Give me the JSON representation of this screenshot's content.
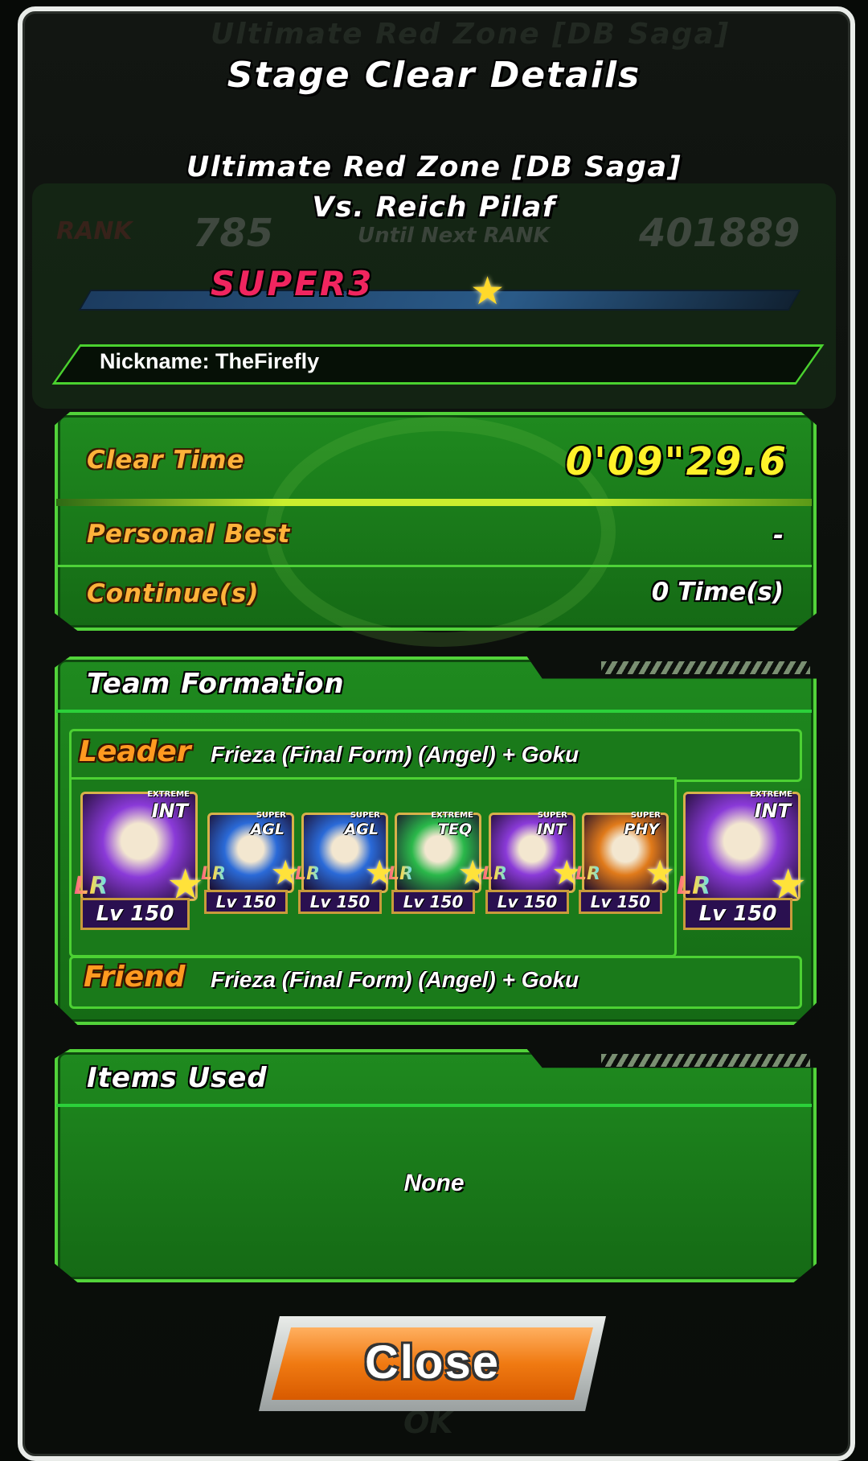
{
  "dialog": {
    "title": "Stage Clear Details",
    "stage_name": "Ultimate Red Zone [DB Saga]",
    "opponent": "Vs. Reich Pilaf"
  },
  "background_ghost": {
    "header": "Ultimate Red Zone [DB Saga]",
    "rank_label": "RANK",
    "rank_value": "785",
    "until_next": "Until Next RANK",
    "next_value": "401889",
    "ok_label": "OK"
  },
  "rank": {
    "tier": "SUPER3",
    "star_icon": "star-icon"
  },
  "nickname": {
    "text": "Nickname:  TheFirefly"
  },
  "stats": {
    "clear_time_label": "Clear Time",
    "clear_time_value": "0'09\"29.6",
    "personal_best_label": "Personal Best",
    "personal_best_value": "-",
    "continues_label": "Continue(s)",
    "continues_value": "0 Time(s)"
  },
  "team": {
    "title": "Team Formation",
    "leader_label": "Leader",
    "leader_name": "Frieza (Final Form) (Angel) + Goku",
    "friend_label": "Friend",
    "friend_name": "Frieza (Final Form) (Angel) + Goku",
    "cards": [
      {
        "tag": "EXTREME",
        "type": "INT",
        "rarity": "LR",
        "level": "Lv 150",
        "color": "#8a3ad8",
        "role": "leader"
      },
      {
        "tag": "SUPER",
        "type": "AGL",
        "rarity": "LR",
        "level": "Lv 150",
        "color": "#2a6ad8",
        "role": "member"
      },
      {
        "tag": "SUPER",
        "type": "AGL",
        "rarity": "LR",
        "level": "Lv 150",
        "color": "#2a6ad8",
        "role": "member"
      },
      {
        "tag": "EXTREME",
        "type": "TEQ",
        "rarity": "LR",
        "level": "Lv 150",
        "color": "#2ab84a",
        "role": "member"
      },
      {
        "tag": "SUPER",
        "type": "INT",
        "rarity": "LR",
        "level": "Lv 150",
        "color": "#8a3ad8",
        "role": "member"
      },
      {
        "tag": "SUPER",
        "type": "PHY",
        "rarity": "LR",
        "level": "Lv 150",
        "color": "#e07a1a",
        "role": "member"
      },
      {
        "tag": "EXTREME",
        "type": "INT",
        "rarity": "LR",
        "level": "Lv 150",
        "color": "#8a3ad8",
        "role": "friend"
      }
    ]
  },
  "items": {
    "title": "Items Used",
    "value": "None"
  },
  "close_button": {
    "label": "Close"
  }
}
